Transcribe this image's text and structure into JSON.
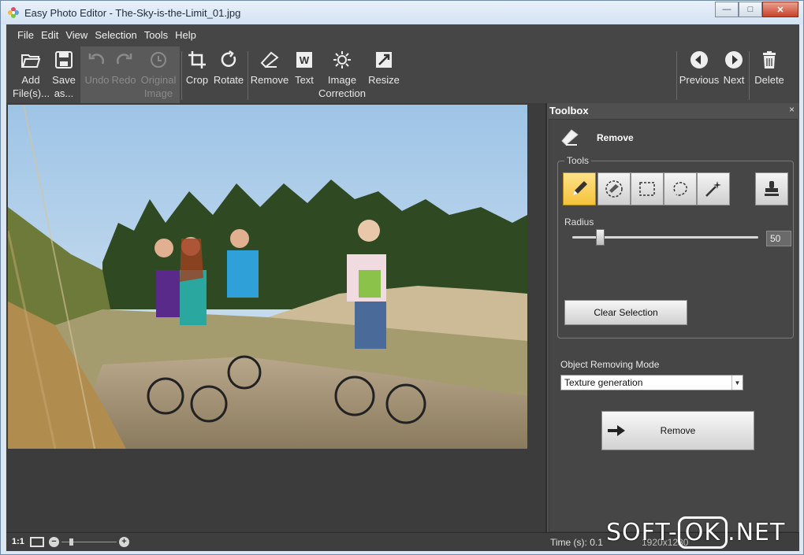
{
  "window": {
    "title": "Easy Photo Editor - The-Sky-is-the-Limit_01.jpg",
    "buttons": {
      "minimize": "—",
      "maximize": "□",
      "close": "✕"
    }
  },
  "menu": [
    "File",
    "Edit",
    "View",
    "Selection",
    "Tools",
    "Help"
  ],
  "toolbar": {
    "add_files": "Add File(s)...",
    "save_as": "Save as...",
    "undo": "Undo",
    "redo": "Redo",
    "original_image": "Original Image",
    "crop": "Crop",
    "rotate": "Rotate",
    "remove": "Remove",
    "text": "Text",
    "image_correction": "Image Correction",
    "resize": "Resize",
    "previous": "Previous",
    "next": "Next",
    "delete": "Delete"
  },
  "toolbox": {
    "title": "Toolbox",
    "close": "×",
    "heading": "Remove",
    "tools_legend": "Tools",
    "tools": [
      "pencil-tool",
      "eraser-selection-tool",
      "rect-selection-tool",
      "lasso-tool",
      "magic-wand-tool",
      "stamp-tool"
    ],
    "active_tool": "pencil-tool",
    "radius_label": "Radius",
    "radius_value": "50",
    "radius_fraction": 0.15,
    "clear_selection": "Clear Selection",
    "mode_label": "Object Removing Mode",
    "mode_value": "Texture generation",
    "remove_button": "Remove"
  },
  "statusbar": {
    "zoom": "1:1",
    "time": "Time (s): 0.1",
    "dims": "1920x1280"
  },
  "watermark": {
    "left": "SOFT-",
    "ok": "OK",
    "right": ".NET"
  },
  "colors": {
    "app_bg": "#464646",
    "active_tool": "#f5c23a",
    "panel_bg": "#505050"
  }
}
